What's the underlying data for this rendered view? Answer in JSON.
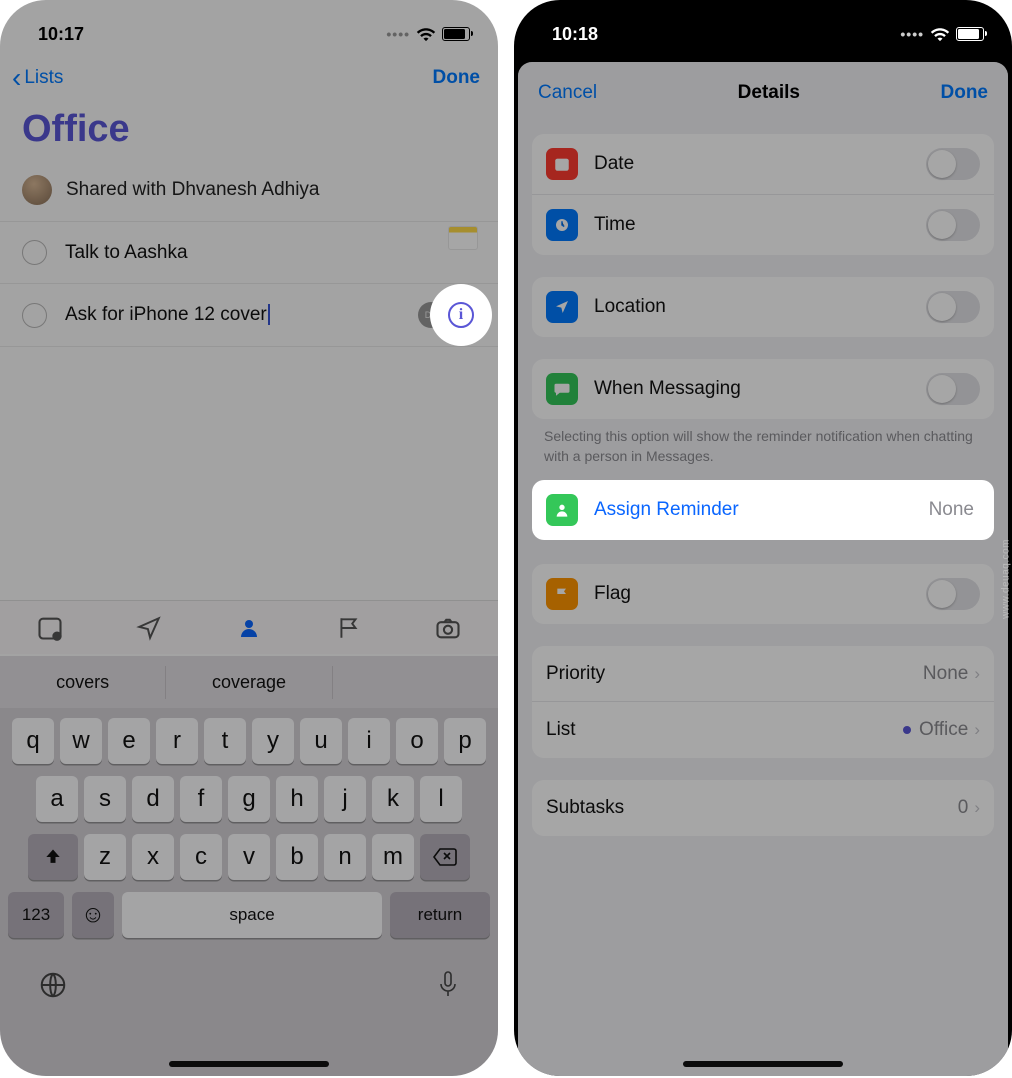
{
  "watermark": "www.deuaq.com",
  "left": {
    "status": {
      "time": "10:17"
    },
    "nav": {
      "back": "Lists",
      "done": "Done"
    },
    "list_title": "Office",
    "shared_with": "Shared with Dhvanesh Adhiya",
    "reminders": [
      {
        "text": "Talk to Aashka"
      },
      {
        "text": "Ask for iPhone 12 cover",
        "assignee_initials": "DB"
      }
    ],
    "suggestions": [
      "covers",
      "coverage"
    ],
    "keyboard": {
      "row1": [
        "q",
        "w",
        "e",
        "r",
        "t",
        "y",
        "u",
        "i",
        "o",
        "p"
      ],
      "row2": [
        "a",
        "s",
        "d",
        "f",
        "g",
        "h",
        "j",
        "k",
        "l"
      ],
      "row3": [
        "z",
        "x",
        "c",
        "v",
        "b",
        "n",
        "m"
      ],
      "num": "123",
      "space": "space",
      "ret": "return"
    }
  },
  "right": {
    "status": {
      "time": "10:18"
    },
    "nav": {
      "cancel": "Cancel",
      "title": "Details",
      "done": "Done"
    },
    "rows": {
      "date": "Date",
      "time": "Time",
      "location": "Location",
      "messaging": "When Messaging",
      "messaging_footer": "Selecting this option will show the reminder notification when chatting with a person in Messages.",
      "assign": "Assign Reminder",
      "assign_value": "None",
      "flag": "Flag",
      "priority": "Priority",
      "priority_value": "None",
      "list": "List",
      "list_value": "Office",
      "subtasks": "Subtasks",
      "subtasks_value": "0"
    }
  }
}
